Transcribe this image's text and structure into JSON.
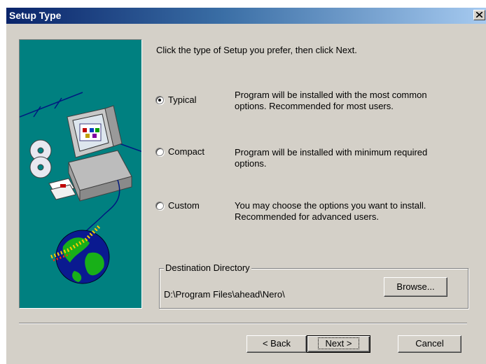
{
  "window": {
    "title": "Setup Type"
  },
  "prompt": "Click the type of Setup you prefer, then click Next.",
  "options": [
    {
      "label": "Typical",
      "selected": true,
      "description_line1": "Program will be installed with the most common",
      "description_line2": "options. Recommended for most users."
    },
    {
      "label": "Compact",
      "selected": false,
      "description_line1": "Program will be installed with minimum required",
      "description_line2": "options."
    },
    {
      "label": "Custom",
      "selected": false,
      "description_line1": "You may choose the options you want to install.",
      "description_line2": "Recommended for advanced users."
    }
  ],
  "destination": {
    "legend": "Destination Directory",
    "path": "D:\\Program Files\\ahead\\Nero\\",
    "browse_label": "Browse..."
  },
  "buttons": {
    "back": "< Back",
    "next": "Next >",
    "cancel": "Cancel"
  },
  "colors": {
    "title_start": "#0a246a",
    "title_end": "#a6caf0",
    "face": "#d4d0c8",
    "art_bg": "#008080"
  },
  "icons": {
    "close": "close-icon",
    "illustration": "computer-globe-illustration"
  }
}
